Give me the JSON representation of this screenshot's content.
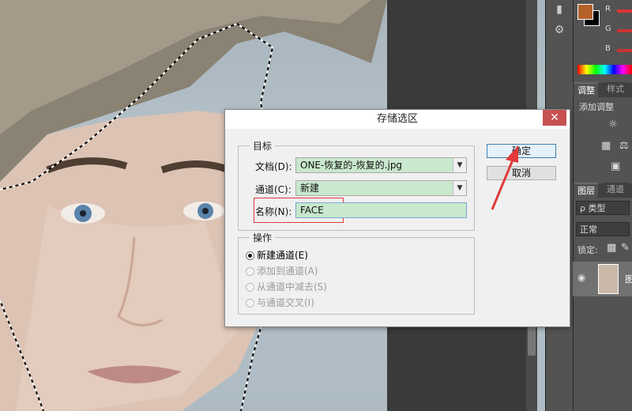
{
  "dialog": {
    "title": "存储选区",
    "close_label": "✕",
    "target_group": {
      "legend": "目标",
      "document": {
        "label": "文档(D):",
        "value": "ONE-恢复的-恢复的.jpg"
      },
      "channel": {
        "label": "通道(C):",
        "value": "新建"
      },
      "name": {
        "label": "名称(N):",
        "value": "FACE"
      }
    },
    "operation_group": {
      "legend": "操作",
      "options": [
        {
          "label": "新建通道(E)",
          "selected": true,
          "enabled": true
        },
        {
          "label": "添加到通道(A)",
          "selected": false,
          "enabled": false
        },
        {
          "label": "从通道中减去(S)",
          "selected": false,
          "enabled": false
        },
        {
          "label": "与通道交叉(I)",
          "selected": false,
          "enabled": false
        }
      ]
    },
    "ok_label": "确定",
    "cancel_label": "取消"
  },
  "right_panel": {
    "color": {
      "r_label": "R",
      "g_label": "G",
      "b_label": "B",
      "fg_color": "#b4612a",
      "bg_color": "#000000"
    },
    "adjust_tabs": [
      "调整",
      "样式"
    ],
    "adjust_hint": "添加调整",
    "layers_tabs": [
      "图层",
      "通道"
    ],
    "kind_filter": "ρ 类型",
    "blend_mode": "正常",
    "lock_label": "锁定:",
    "layer_name": "图"
  },
  "colors": {
    "accent_red": "#e03a3a",
    "field_green": "#c9e8cd",
    "close_red": "#c75050"
  }
}
